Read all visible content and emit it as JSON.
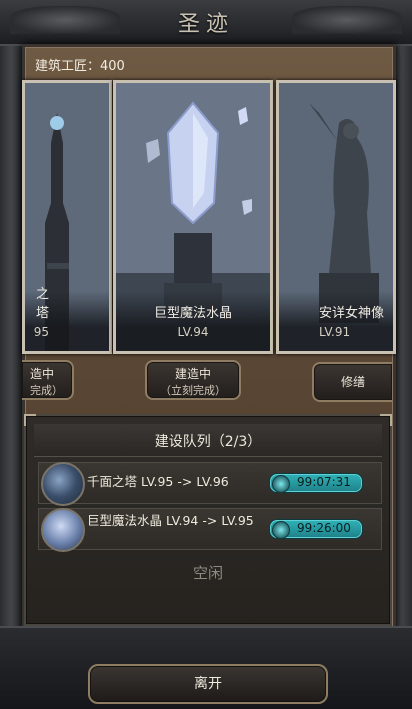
{
  "header": {
    "title": "圣迹"
  },
  "resources": {
    "craftsman_label": "建筑工匠：400"
  },
  "cards": [
    {
      "name": "之塔",
      "level": "95",
      "art_icon": "tower-icon"
    },
    {
      "name": "巨型魔法水晶",
      "level": "LV.94",
      "art_icon": "crystal-icon"
    },
    {
      "name": "安详女神像",
      "level": "LV.91",
      "art_icon": "statue-icon"
    }
  ],
  "actions": {
    "left": {
      "line1": "造中",
      "line2": "完成）"
    },
    "mid": {
      "line1": "建造中",
      "line2": "（立刻完成）"
    },
    "right": {
      "line1": "修缮"
    }
  },
  "queue": {
    "title": "建设队列（2/3）",
    "items": [
      {
        "desc": "千面之塔 LV.95 -> LV.96",
        "timer": "99:07:31",
        "icon": "tower-thumb-icon"
      },
      {
        "desc": "巨型魔法水晶 LV.94 -> LV.95",
        "timer": "99:26:00",
        "icon": "crystal-thumb-icon"
      }
    ],
    "idle_label": "空闲"
  },
  "footer": {
    "leave_label": "离开"
  }
}
